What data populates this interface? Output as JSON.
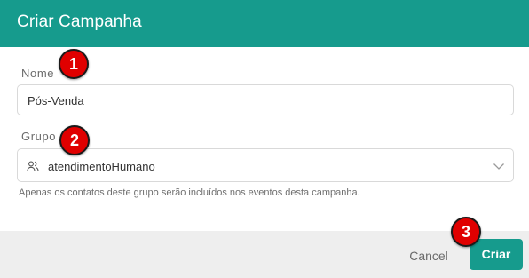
{
  "dialog": {
    "title": "Criar Campanha"
  },
  "form": {
    "name_label": "Nome",
    "name_value": "Pós-Venda",
    "group_label": "Grupo",
    "group_value": "atendimentoHumano",
    "group_icon": "users-icon",
    "group_dropdown_icon": "chevron-down-icon",
    "helper_text": "Apenas os contatos deste grupo serão incluídos nos eventos desta campanha."
  },
  "footer": {
    "cancel_label": "Cancel",
    "create_label": "Criar"
  },
  "markers": [
    "1",
    "2",
    "3"
  ],
  "colors": {
    "accent": "#169b8d",
    "marker": "#e00000"
  }
}
